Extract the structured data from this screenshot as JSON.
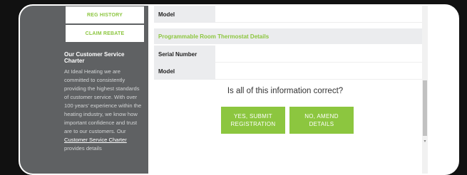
{
  "sidebar": {
    "reg_history": "REG HISTORY",
    "claim_rebate": "CLAIM REBATE",
    "charter_title": "Our Customer Service Charter",
    "charter_text": "At Ideal Heating we are committed to consistently providing the highest standards of customer service. With over 100 years' experience within the heating industry, we know how important confidence and trust are to our customers. Our ",
    "charter_link": "Customer Service Charter",
    "charter_after": " provides details"
  },
  "details": {
    "model_label_top": "Model",
    "section_title": "Programmable Room Thermostat Details",
    "serial_label": "Serial Number",
    "model_label": "Model"
  },
  "confirm": {
    "question": "Is all of this information correct?",
    "yes_line1": "YES, SUBMIT",
    "yes_line2": "REGISTRATION",
    "no_line1": "NO, AMEND",
    "no_line2": "DETAILS"
  },
  "colors": {
    "accent": "#8cc63f",
    "sidebar": "#5f6163"
  },
  "icons": {
    "scroll_down": "scroll-down-arrow-icon"
  }
}
